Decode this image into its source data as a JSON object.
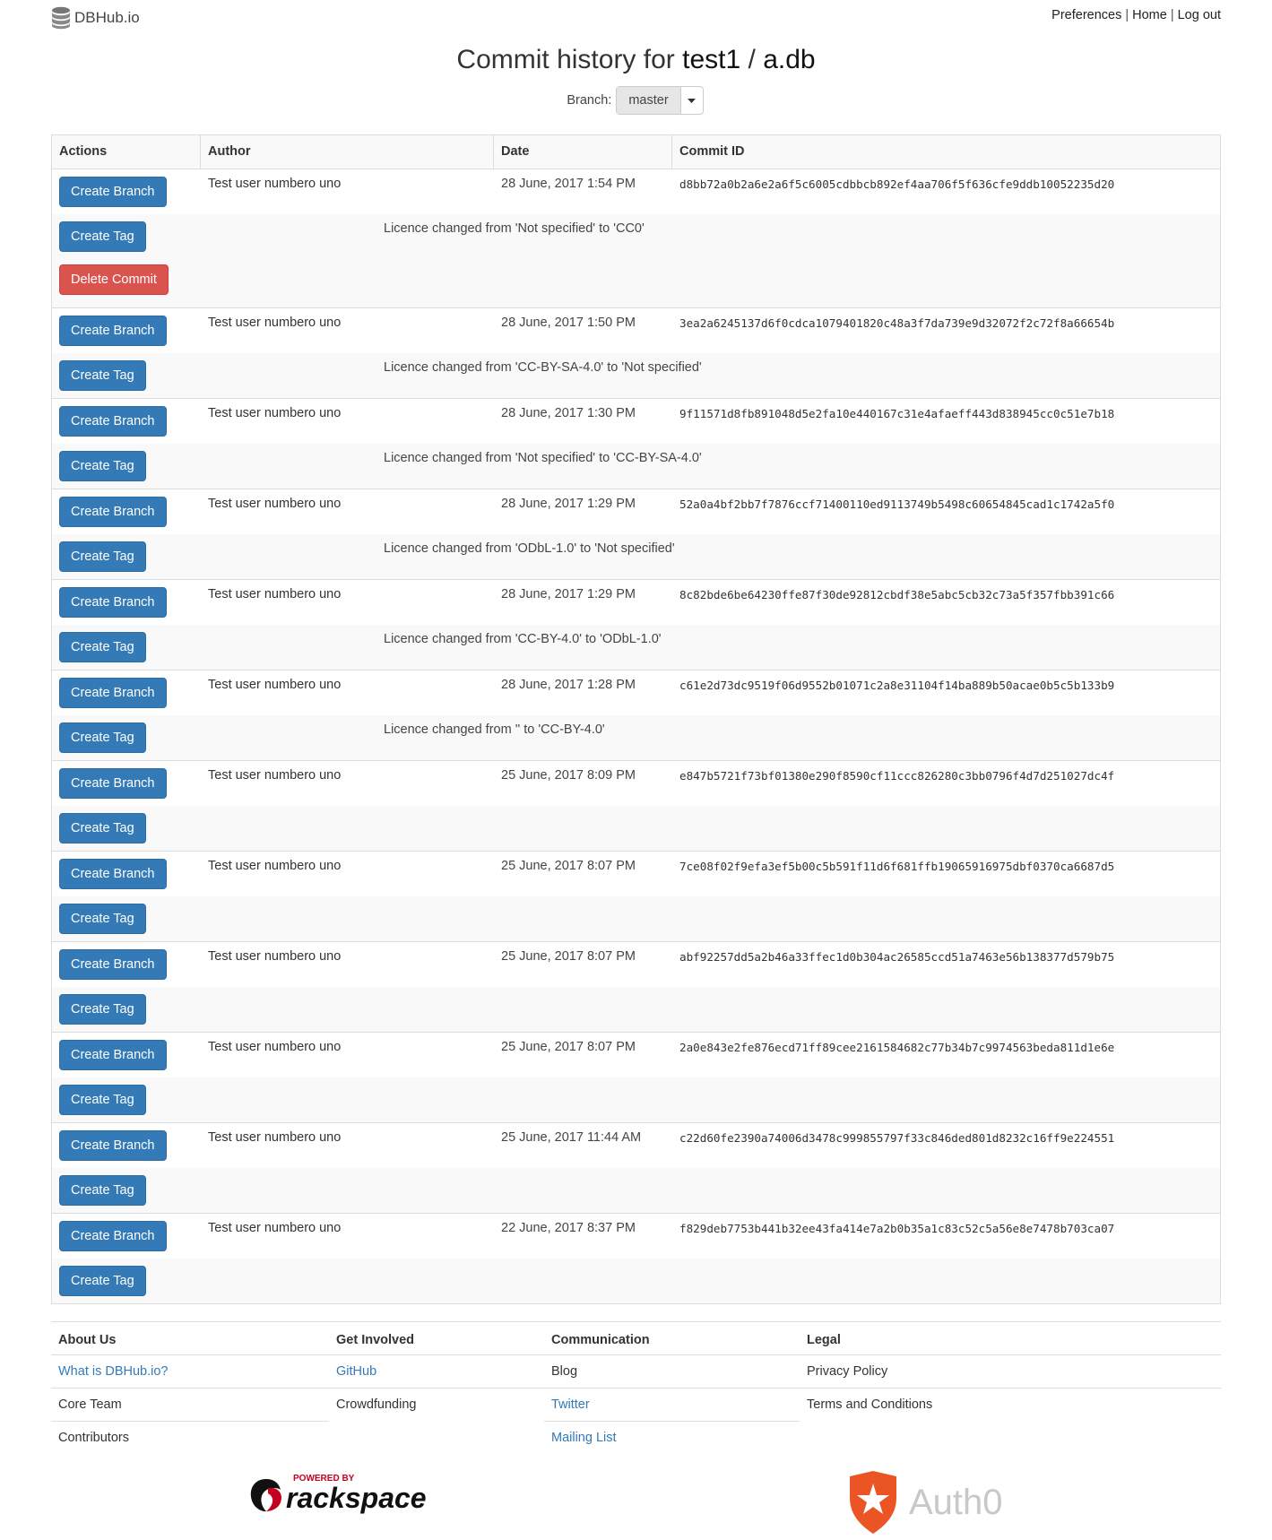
{
  "brand": {
    "name": "DBHub.io"
  },
  "topnav": {
    "preferences": "Preferences",
    "home": "Home",
    "logout": "Log out",
    "sep": "|"
  },
  "page": {
    "title_prefix": "Commit history for",
    "owner": "test1",
    "slash": "/",
    "db": "a.db"
  },
  "branch": {
    "label": "Branch:",
    "value": "master"
  },
  "table": {
    "headers": {
      "actions": "Actions",
      "author": "Author",
      "date": "Date",
      "commit_id": "Commit ID"
    },
    "labels": {
      "create_branch": "Create Branch",
      "create_tag": "Create Tag",
      "delete_commit": "Delete Commit"
    },
    "commits": [
      {
        "author": "Test user numbero uno",
        "date": "28 June, 2017 1:54 PM",
        "id": "d8bb72a0b2a6e2a6f5c6005cdbbcb892ef4aa706f5f636cfe9ddb10052235d20",
        "message": "Licence changed from 'Not specified' to 'CC0'",
        "deletable": true
      },
      {
        "author": "Test user numbero uno",
        "date": "28 June, 2017 1:50 PM",
        "id": "3ea2a6245137d6f0cdca1079401820c48a3f7da739e9d32072f2c72f8a66654b",
        "message": "Licence changed from 'CC-BY-SA-4.0' to 'Not specified'"
      },
      {
        "author": "Test user numbero uno",
        "date": "28 June, 2017 1:30 PM",
        "id": "9f11571d8fb891048d5e2fa10e440167c31e4afaeff443d838945cc0c51e7b18",
        "message": "Licence changed from 'Not specified' to 'CC-BY-SA-4.0'"
      },
      {
        "author": "Test user numbero uno",
        "date": "28 June, 2017 1:29 PM",
        "id": "52a0a4bf2bb7f7876ccf71400110ed9113749b5498c60654845cad1c1742a5f0",
        "message": "Licence changed from 'ODbL-1.0' to 'Not specified'"
      },
      {
        "author": "Test user numbero uno",
        "date": "28 June, 2017 1:29 PM",
        "id": "8c82bde6be64230ffe87f30de92812cbdf38e5abc5cb32c73a5f357fbb391c66",
        "message": "Licence changed from 'CC-BY-4.0' to 'ODbL-1.0'"
      },
      {
        "author": "Test user numbero uno",
        "date": "28 June, 2017 1:28 PM",
        "id": "c61e2d73dc9519f06d9552b01071c2a8e31104f14ba889b50acae0b5c5b133b9",
        "message": "Licence changed from '' to 'CC-BY-4.0'"
      },
      {
        "author": "Test user numbero uno",
        "date": "25 June, 2017 8:09 PM",
        "id": "e847b5721f73bf01380e290f8590cf11ccc826280c3bb0796f4d7d251027dc4f",
        "message": ""
      },
      {
        "author": "Test user numbero uno",
        "date": "25 June, 2017 8:07 PM",
        "id": "7ce08f02f9efa3ef5b00c5b591f11d6f681ffb19065916975dbf0370ca6687d5",
        "message": ""
      },
      {
        "author": "Test user numbero uno",
        "date": "25 June, 2017 8:07 PM",
        "id": "abf92257dd5a2b46a33ffec1d0b304ac26585ccd51a7463e56b138377d579b75",
        "message": ""
      },
      {
        "author": "Test user numbero uno",
        "date": "25 June, 2017 8:07 PM",
        "id": "2a0e843e2fe876ecd71ff89cee2161584682c77b34b7c9974563beda811d1e6e",
        "message": ""
      },
      {
        "author": "Test user numbero uno",
        "date": "25 June, 2017 11:44 AM",
        "id": "c22d60fe2390a74006d3478c999855797f33c846ded801d8232c16ff9e224551",
        "message": ""
      },
      {
        "author": "Test user numbero uno",
        "date": "22 June, 2017 8:37 PM",
        "id": "f829deb7753b441b32ee43fa414e7a2b0b35a1c83c52c5a56e8e7478b703ca07",
        "message": ""
      }
    ]
  },
  "footer": {
    "columns": [
      {
        "heading": "About Us",
        "items": [
          {
            "label": "What is DBHub.io?",
            "link": true
          },
          {
            "label": "Core Team",
            "link": false
          },
          {
            "label": "Contributors",
            "link": false
          }
        ]
      },
      {
        "heading": "Get Involved",
        "items": [
          {
            "label": "GitHub",
            "link": true
          },
          {
            "label": "Crowdfunding",
            "link": false
          }
        ]
      },
      {
        "heading": "Communication",
        "items": [
          {
            "label": "Blog",
            "link": false
          },
          {
            "label": "Twitter",
            "link": true
          },
          {
            "label": "Mailing List",
            "link": true
          }
        ]
      },
      {
        "heading": "Legal",
        "items": [
          {
            "label": "Privacy Policy",
            "link": false
          },
          {
            "label": "Terms and Conditions",
            "link": false
          }
        ]
      }
    ],
    "sponsors": {
      "rackspace_small": "POWERED BY",
      "rackspace_name": "rackspace",
      "auth0_name": "Auth0"
    }
  },
  "colors": {
    "primary": "#337ab7",
    "danger": "#d9534f",
    "rackspace_red": "#c40022",
    "auth0_orange": "#eb5424"
  }
}
